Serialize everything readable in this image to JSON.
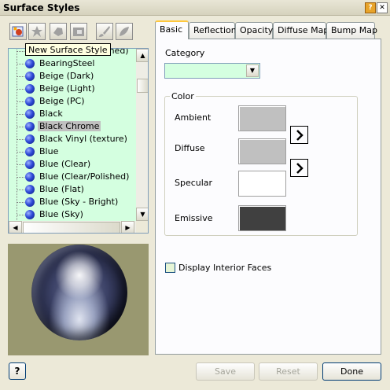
{
  "window": {
    "title": "Surface Styles",
    "help_glyph": "?",
    "close_glyph": "✕"
  },
  "toolbar": {
    "buttons": [
      "new-style",
      "purge-styles",
      "import-style",
      "export-style",
      "paint-brush",
      "paint-brush-alt"
    ],
    "tooltip": "New Surface Style"
  },
  "style_list": {
    "items": [
      "Aluminum (Polished)",
      "BearingSteel",
      "Beige (Dark)",
      "Beige (Light)",
      "Beige (PC)",
      "Black",
      "Black Chrome",
      "Black Vinyl (texture)",
      "Blue",
      "Blue (Clear)",
      "Blue (Clear/Polished)",
      "Blue (Flat)",
      "Blue (Sky - Bright)",
      "Blue (Sky)"
    ],
    "selected": "Black Chrome",
    "scroll_up": "▲",
    "scroll_down": "▼",
    "scroll_left": "◀",
    "scroll_right": "▶",
    "list_bg": "#d4ffe0"
  },
  "tabs": [
    {
      "label": "Basic",
      "active": true
    },
    {
      "label": "Reflection"
    },
    {
      "label": "Opacity"
    },
    {
      "label": "Diffuse Map"
    },
    {
      "label": "Bump Map"
    }
  ],
  "basic": {
    "category_label": "Category",
    "category_value": "",
    "category_arrow": "▼",
    "color_group_label": "Color",
    "colors": [
      {
        "label": "Ambient",
        "hex": "#c0c0c0"
      },
      {
        "label": "Diffuse",
        "hex": "#c0c0c0"
      },
      {
        "label": "Specular",
        "hex": "#ffffff"
      },
      {
        "label": "Emissive",
        "hex": "#404040"
      }
    ],
    "display_interior_faces": {
      "label": "Display Interior Faces",
      "checked": false
    }
  },
  "footer": {
    "help": "?",
    "save": "Save",
    "reset": "Reset",
    "done": "Done"
  }
}
